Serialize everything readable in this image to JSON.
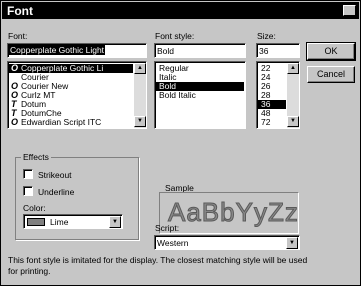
{
  "window": {
    "title": "Font",
    "help_glyph": "?"
  },
  "font": {
    "label": "Font:",
    "value": "Copperplate Gothic Light",
    "items": [
      {
        "name": "Copperplate Gothic Li",
        "glyph": "O",
        "selected": true
      },
      {
        "name": "Courier",
        "glyph": "",
        "selected": false
      },
      {
        "name": "Courier New",
        "glyph": "O",
        "selected": false
      },
      {
        "name": "Curlz MT",
        "glyph": "O",
        "selected": false
      },
      {
        "name": "Dotum",
        "glyph": "T",
        "selected": false
      },
      {
        "name": "DotumChe",
        "glyph": "T",
        "selected": false
      },
      {
        "name": "Edwardian Script ITC",
        "glyph": "O",
        "selected": false
      }
    ]
  },
  "style": {
    "label": "Font style:",
    "value": "Bold",
    "items": [
      {
        "name": "Regular",
        "selected": false
      },
      {
        "name": "Italic",
        "selected": false
      },
      {
        "name": "Bold",
        "selected": true
      },
      {
        "name": "Bold Italic",
        "selected": false
      }
    ]
  },
  "size": {
    "label": "Size:",
    "value": "36",
    "items": [
      {
        "name": "22",
        "selected": false
      },
      {
        "name": "24",
        "selected": false
      },
      {
        "name": "26",
        "selected": false
      },
      {
        "name": "28",
        "selected": false
      },
      {
        "name": "36",
        "selected": true
      },
      {
        "name": "48",
        "selected": false
      },
      {
        "name": "72",
        "selected": false
      }
    ]
  },
  "buttons": {
    "ok": "OK",
    "cancel": "Cancel"
  },
  "effects": {
    "title": "Effects",
    "strikeout": {
      "label": "Strikeout",
      "checked": false
    },
    "underline": {
      "label": "Underline",
      "checked": false
    },
    "color_label": "Color:",
    "color_value": "Lime"
  },
  "sample": {
    "title": "Sample",
    "text": "AaBbYyZz"
  },
  "script": {
    "label": "Script:",
    "value": "Western"
  },
  "hint": "This font style is imitated for the display. The closest matching style will be used for printing.",
  "icons": {
    "scroll_up": "▲",
    "scroll_down": "▼",
    "dropdown": "▼"
  }
}
